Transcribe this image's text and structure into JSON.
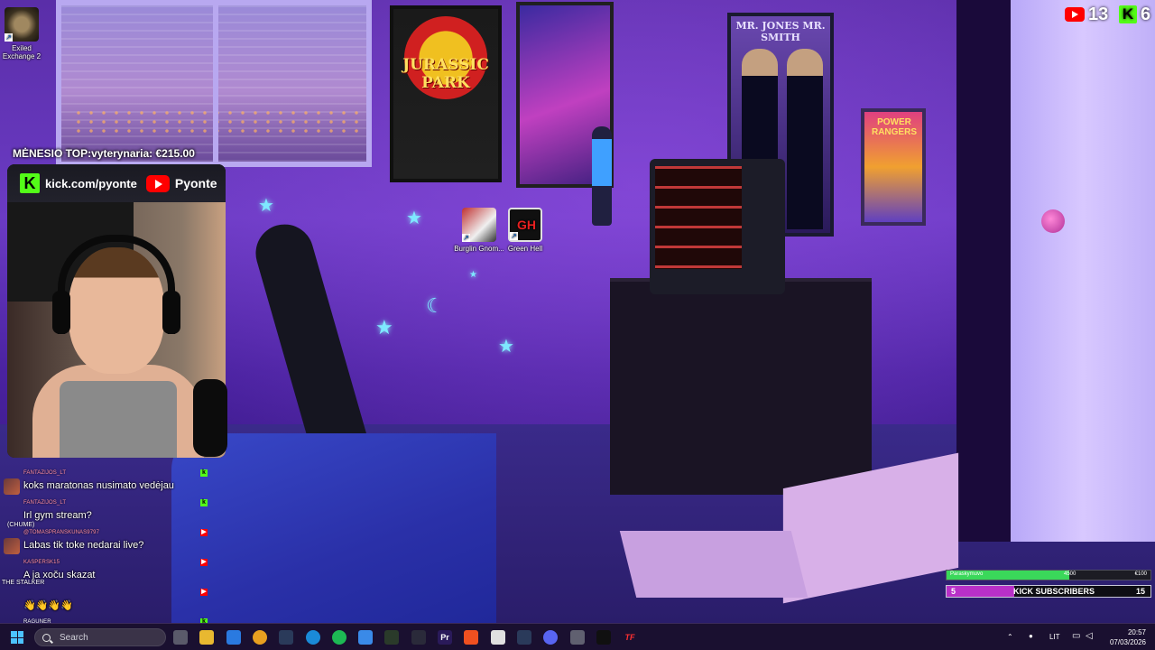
{
  "desktop": {
    "icons": [
      {
        "label": "Exiled Exchange 2",
        "icon": "exiled-exchange-icon"
      },
      {
        "label": "Burglin Gnom...",
        "icon": "burglin-gnomes-icon"
      },
      {
        "label": "Green Hell",
        "icon": "green-hell-icon"
      }
    ]
  },
  "scene": {
    "poster_jp": "JURASSIC PARK",
    "poster_mib": "MR. JONES  MR. SMITH",
    "poster_pr": "POWER RANGERS"
  },
  "overlay": {
    "youtube_count": "13",
    "kick_badge": "K",
    "kick_count": "6",
    "donation": "MĖNESIO TOP:vyterynaria: €215.00",
    "kick_url": "kick.com/pyonte",
    "youtube_name": "Pyonte",
    "side_label_chume": "(CHUME)",
    "side_label_stalker": "THE STALKER"
  },
  "chat": {
    "messages": [
      {
        "user": "FANTAZIJOS_LT",
        "text": "koks maratonas nusimato vedėjau",
        "platform": "kick"
      },
      {
        "user": "FANTAZIJOS_LT",
        "text": "Irl gym stream?",
        "platform": "kick"
      },
      {
        "user": "@TOMASPRANSKUNAS9797",
        "text": "Labas tik toke nedarai live?",
        "platform": "youtube"
      },
      {
        "user": "KASPERSK15",
        "text": "A ja xoču skazat",
        "platform": "youtube"
      },
      {
        "user": "",
        "text": "👋👋👋👋",
        "platform": "youtube"
      },
      {
        "user": "RAGUNER",
        "text": "",
        "platform": "kick"
      }
    ]
  },
  "goals": {
    "bar1": {
      "left": "Paraskymuvo",
      "mid": "4500",
      "right": "€100",
      "fill_fraction": 0.6
    },
    "subs": {
      "current": "5",
      "label": "KICK SUBSCRIBERS",
      "target": "15",
      "fill_fraction": 0.33
    }
  },
  "taskbar": {
    "search_placeholder": "Search",
    "apps": [
      {
        "name": "file-manager-icon",
        "glyph": ""
      },
      {
        "name": "files-icon",
        "glyph": ""
      },
      {
        "name": "store-icon",
        "glyph": ""
      },
      {
        "name": "chrome-icon",
        "glyph": ""
      },
      {
        "name": "steam-icon",
        "glyph": ""
      },
      {
        "name": "edge-icon",
        "glyph": ""
      },
      {
        "name": "spotify-icon",
        "glyph": ""
      },
      {
        "name": "photos-icon",
        "glyph": ""
      },
      {
        "name": "nvidia-icon",
        "glyph": ""
      },
      {
        "name": "obs-icon",
        "glyph": ""
      },
      {
        "name": "premiere-icon",
        "glyph": "Pr"
      },
      {
        "name": "brave-icon",
        "glyph": ""
      },
      {
        "name": "notes-icon",
        "glyph": ""
      },
      {
        "name": "steam-2-icon",
        "glyph": ""
      },
      {
        "name": "discord-icon",
        "glyph": ""
      },
      {
        "name": "settings-icon",
        "glyph": ""
      },
      {
        "name": "tiktok-icon",
        "glyph": ""
      },
      {
        "name": "tf-icon",
        "glyph": "TF"
      }
    ],
    "language": "LIT",
    "time": "20:57",
    "date": "07/03/2026"
  },
  "colors": {
    "kick_green": "#53fc18",
    "youtube_red": "#ff0000",
    "chat_username": "#ff8fa0",
    "subs_fill": "#b830c8",
    "goal_fill": "#3ad85a"
  }
}
